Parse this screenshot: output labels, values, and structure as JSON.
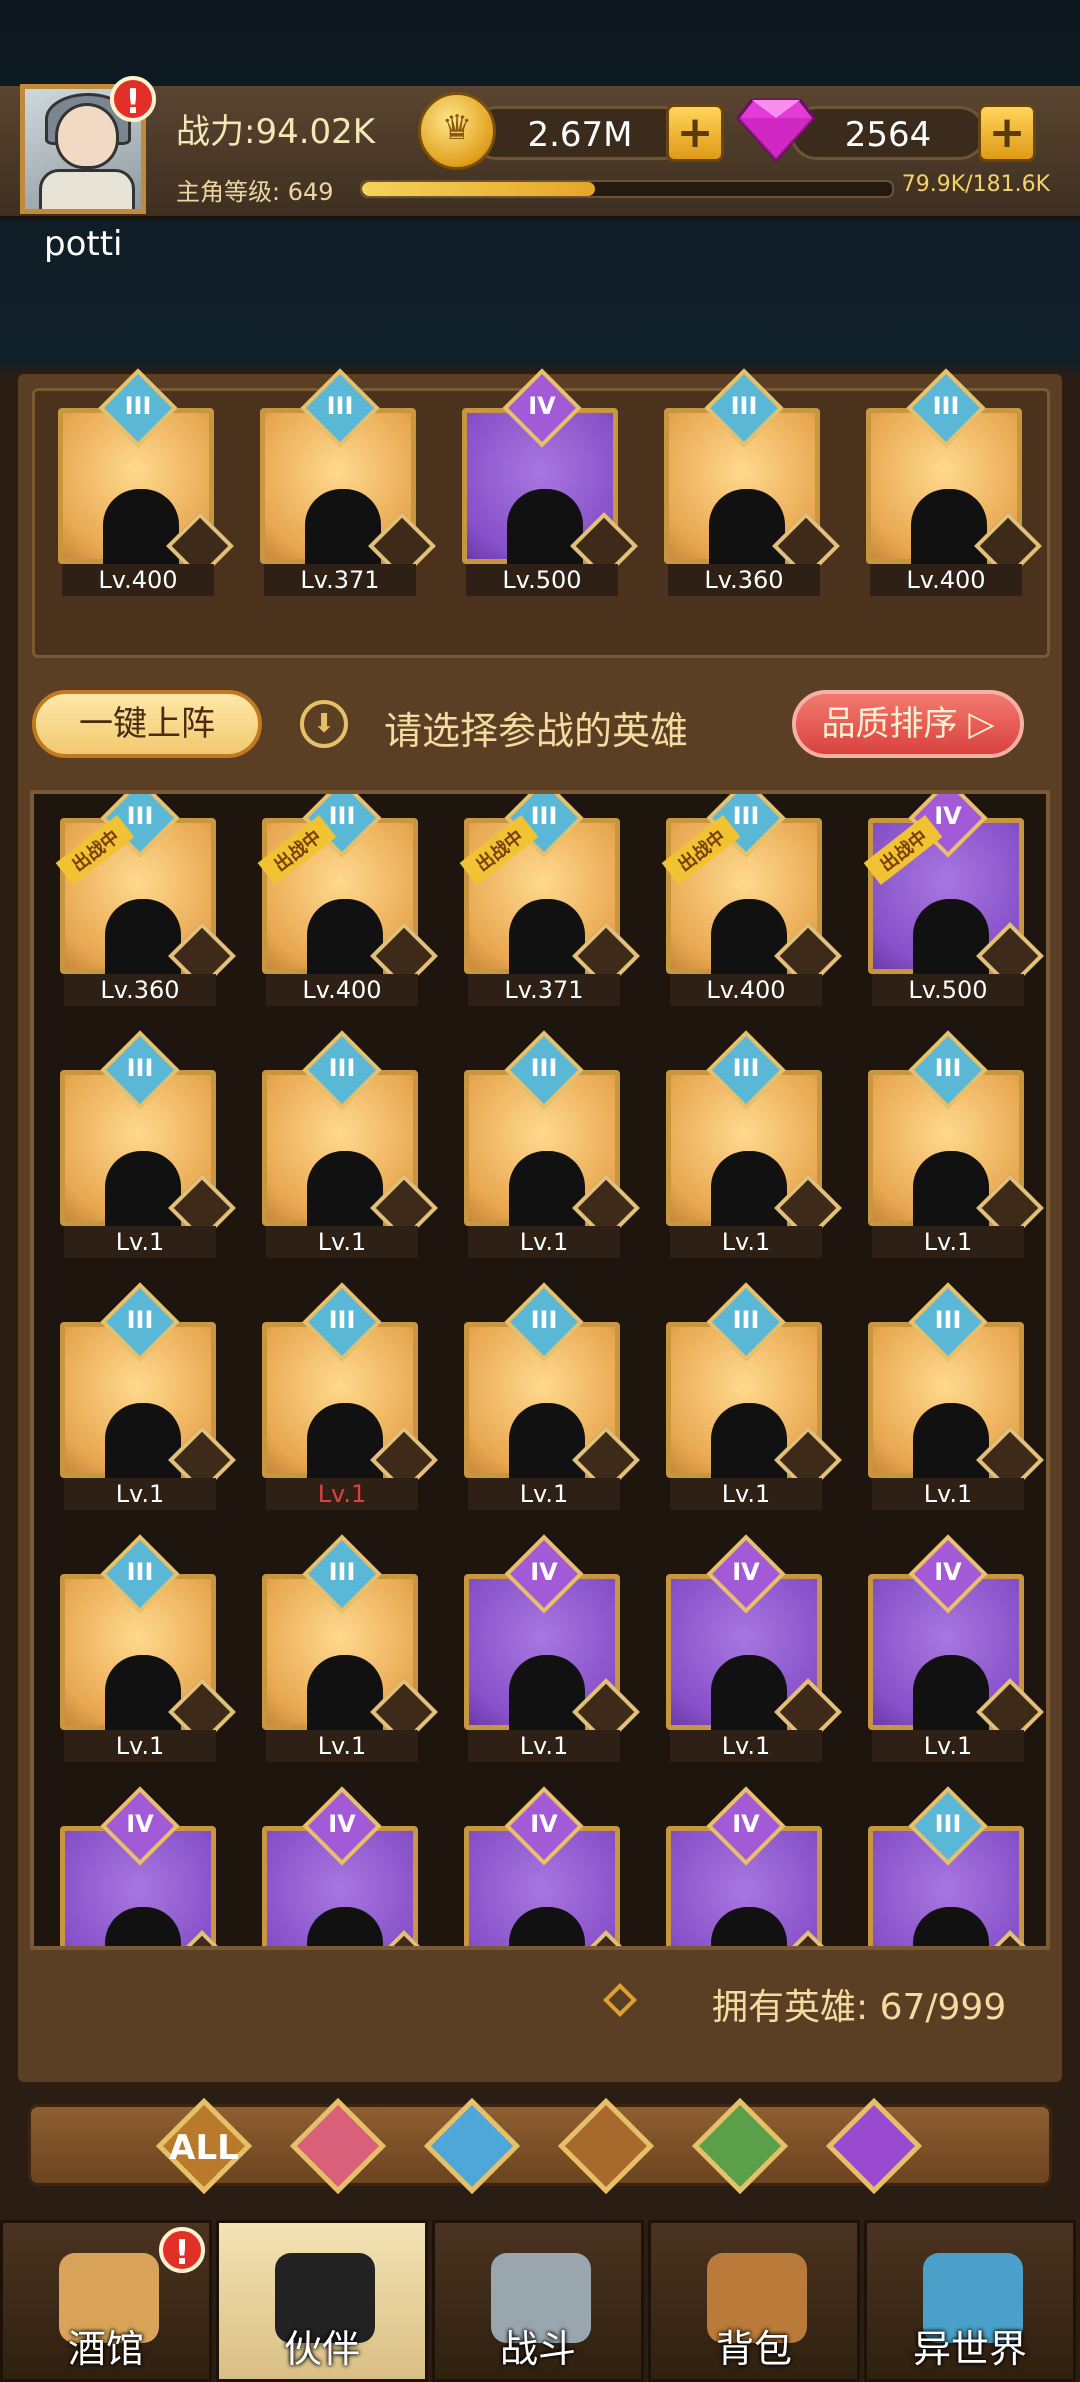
{
  "player": {
    "name": "potti",
    "alert": "!",
    "power": "战力:94.02K",
    "level_label": "主角等级:",
    "level": "649",
    "xp_text": "79.9K/181.6K",
    "xp_fraction": 0.44
  },
  "currency": {
    "coins": "2.67M",
    "gems": "2564",
    "plus": "+"
  },
  "team": [
    {
      "level": "Lv.400",
      "rank": "III",
      "bg": "gold"
    },
    {
      "level": "Lv.371",
      "rank": "III",
      "bg": "gold"
    },
    {
      "level": "Lv.500",
      "rank": "IV",
      "bg": "purple"
    },
    {
      "level": "Lv.360",
      "rank": "III",
      "bg": "gold"
    },
    {
      "level": "Lv.400",
      "rank": "III",
      "bg": "gold"
    }
  ],
  "controls": {
    "auto_deploy": "一键上阵",
    "prompt": "请选择参战的英雄",
    "sort": "品质排序"
  },
  "deployed_tag": "出战中",
  "heroes": [
    {
      "level": "Lv.360",
      "rank": "III",
      "bg": "gold",
      "deployed": true
    },
    {
      "level": "Lv.400",
      "rank": "III",
      "bg": "gold",
      "deployed": true
    },
    {
      "level": "Lv.371",
      "rank": "III",
      "bg": "gold",
      "deployed": true
    },
    {
      "level": "Lv.400",
      "rank": "III",
      "bg": "gold",
      "deployed": true
    },
    {
      "level": "Lv.500",
      "rank": "IV",
      "bg": "purple",
      "deployed": true
    },
    {
      "level": "Lv.1",
      "rank": "III",
      "bg": "gold"
    },
    {
      "level": "Lv.1",
      "rank": "III",
      "bg": "gold"
    },
    {
      "level": "Lv.1",
      "rank": "III",
      "bg": "gold"
    },
    {
      "level": "Lv.1",
      "rank": "III",
      "bg": "gold"
    },
    {
      "level": "Lv.1",
      "rank": "III",
      "bg": "gold"
    },
    {
      "level": "Lv.1",
      "rank": "III",
      "bg": "gold"
    },
    {
      "level": "Lv.1",
      "rank": "III",
      "bg": "gold",
      "red": true
    },
    {
      "level": "Lv.1",
      "rank": "III",
      "bg": "gold"
    },
    {
      "level": "Lv.1",
      "rank": "III",
      "bg": "gold"
    },
    {
      "level": "Lv.1",
      "rank": "III",
      "bg": "gold"
    },
    {
      "level": "Lv.1",
      "rank": "III",
      "bg": "gold"
    },
    {
      "level": "Lv.1",
      "rank": "III",
      "bg": "gold"
    },
    {
      "level": "Lv.1",
      "rank": "IV",
      "bg": "purple"
    },
    {
      "level": "Lv.1",
      "rank": "IV",
      "bg": "purple"
    },
    {
      "level": "Lv.1",
      "rank": "IV",
      "bg": "purple"
    },
    {
      "level": "",
      "rank": "IV",
      "bg": "purple"
    },
    {
      "level": "",
      "rank": "IV",
      "bg": "purple"
    },
    {
      "level": "",
      "rank": "IV",
      "bg": "purple"
    },
    {
      "level": "",
      "rank": "IV",
      "bg": "purple"
    },
    {
      "level": "",
      "rank": "III",
      "bg": "purple"
    }
  ],
  "owned": {
    "label": "拥有英雄:",
    "count": "67/999"
  },
  "filters": [
    "ALL",
    "human-crown-icon",
    "fish-icon",
    "lion-icon",
    "elf-icon",
    "demon-icon"
  ],
  "nav": [
    {
      "label": "酒馆",
      "icon": "beer-mug-icon",
      "alert": "!"
    },
    {
      "label": "伙伴",
      "icon": "companion-icon",
      "active": true
    },
    {
      "label": "战斗",
      "icon": "crossed-swords-icon"
    },
    {
      "label": "背包",
      "icon": "treasure-chest-icon"
    },
    {
      "label": "异世界",
      "icon": "portal-icon"
    }
  ],
  "colors": {
    "rank_iii": "#5ab8d6",
    "rank_iv": "#a25ad6",
    "sort_button": "#e2585a",
    "accent_gold": "#f5d25b"
  }
}
